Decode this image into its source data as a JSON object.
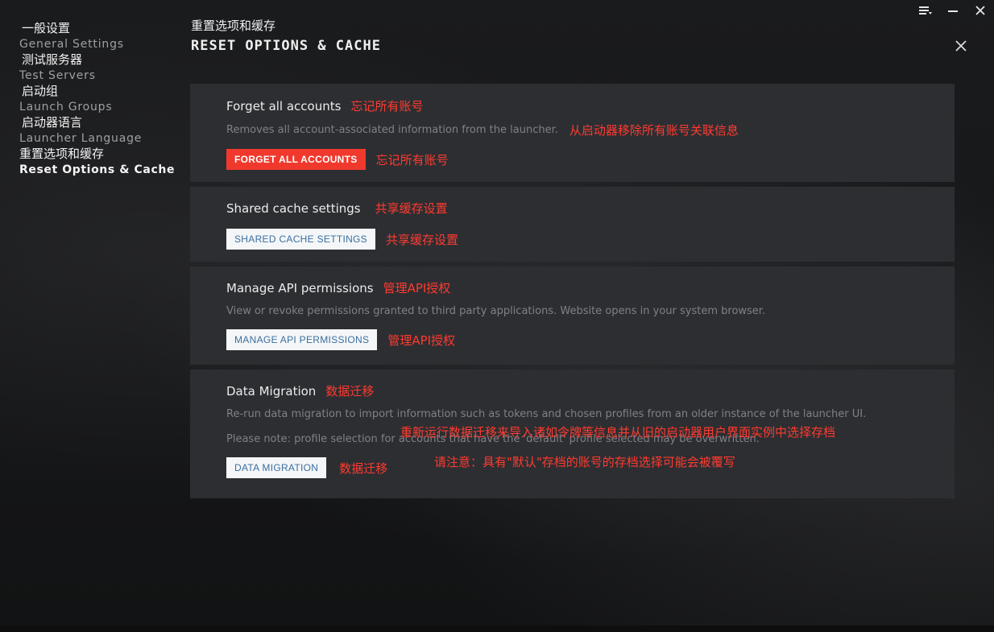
{
  "window": {
    "menu_icon": "menu-icon",
    "minimize_icon": "minimize-icon",
    "close_icon": "close-icon"
  },
  "sidebar": {
    "items": [
      {
        "zh": "一般设置",
        "en": "General Settings"
      },
      {
        "zh": "测试服务器",
        "en": "Test Servers"
      },
      {
        "zh": "启动组",
        "en": "Launch Groups"
      },
      {
        "zh": "启动器语言",
        "en": "Launcher Language"
      },
      {
        "zh": "重置选项和缓存",
        "en": "Reset Options & Cache"
      }
    ]
  },
  "header": {
    "title_zh": "重置选项和缓存",
    "title_en": "RESET OPTIONS & CACHE"
  },
  "panels": {
    "forget": {
      "title": "Forget all accounts",
      "title_zh": "忘记所有账号",
      "desc": "Removes all account-associated information from the launcher.",
      "desc_zh": "从启动器移除所有账号关联信息",
      "button": "FORGET ALL ACCOUNTS",
      "button_zh": "忘记所有账号"
    },
    "shared": {
      "title": "Shared cache settings",
      "title_zh": "共享缓存设置",
      "button": "SHARED CACHE SETTINGS",
      "button_zh": "共享缓存设置"
    },
    "api": {
      "title": "Manage API permissions",
      "title_zh": "管理API授权",
      "desc": "View or revoke permissions granted to third party applications. Website opens in your system browser.",
      "button": "MANAGE API PERMISSIONS",
      "button_zh": "管理API授权"
    },
    "migration": {
      "title": "Data Migration",
      "title_zh": "数据迁移",
      "desc": "Re-run data migration to import information such as tokens and chosen profiles from an older instance of the launcher UI.",
      "desc_zh": "重新运行数据迁移来导入诸如令牌等信息并从旧的启动器用户界面实例中选择存档",
      "note": "Please note: profile selection for accounts that have the 'default' profile selected may be overwritten.",
      "note_zh": "请注意：具有\"默认\"存档的账号的存档选择可能会被覆写",
      "button": "DATA MIGRATION",
      "button_zh": "数据迁移"
    }
  }
}
